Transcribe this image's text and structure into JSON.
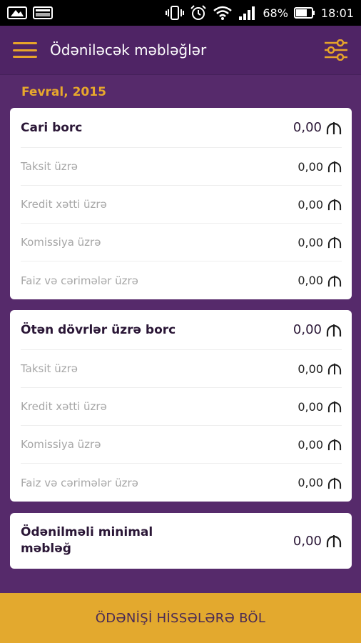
{
  "status_bar": {
    "battery": "68%",
    "time": "18:01"
  },
  "app_bar": {
    "title": "Ödəniləcək məbləğlər"
  },
  "period": "Fevral, 2015",
  "current_debt": {
    "label": "Cari borc",
    "amount": "0,00",
    "rows": [
      {
        "label": "Taksit üzrə",
        "amount": "0,00"
      },
      {
        "label": "Kredit xətti üzrə",
        "amount": "0,00"
      },
      {
        "label": "Komissiya üzrə",
        "amount": "0,00"
      },
      {
        "label": "Faiz və cərimələr üzrə",
        "amount": "0,00"
      }
    ]
  },
  "past_debt": {
    "label": "Ötən dövrlər üzrə borc",
    "amount": "0,00",
    "rows": [
      {
        "label": "Taksit üzrə",
        "amount": "0,00"
      },
      {
        "label": "Kredit xətti üzrə",
        "amount": "0,00"
      },
      {
        "label": "Komissiya üzrə",
        "amount": "0,00"
      },
      {
        "label": "Faiz və cərimələr üzrə",
        "amount": "0,00"
      }
    ]
  },
  "minimal": {
    "label": "Ödənilməli minimal məbləğ",
    "amount": "0,00"
  },
  "bottom_button": {
    "label": "ÖDƏNİŞİ HİSSƏLƏRƏ BÖL"
  },
  "colors": {
    "primary": "#4f2465",
    "accent": "#e3a92e"
  }
}
